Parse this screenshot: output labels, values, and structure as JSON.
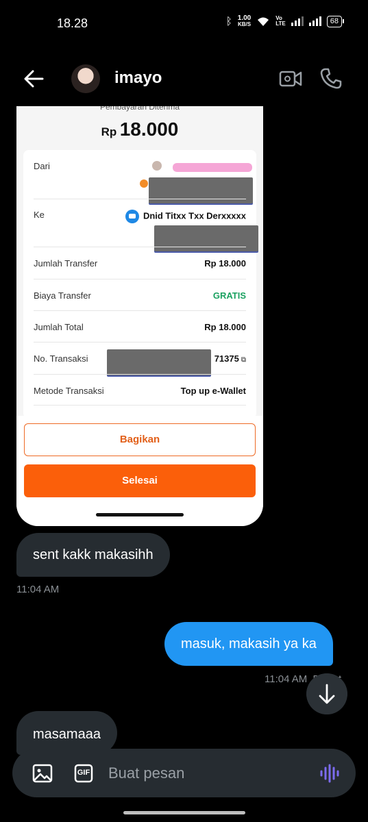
{
  "status_bar": {
    "time": "18.28",
    "net_speed_value": "1.00",
    "net_speed_unit": "KB/S",
    "volte_top": "Vo",
    "volte_bottom": "LTE",
    "battery": "68"
  },
  "header": {
    "contact_name": "imayo"
  },
  "receipt": {
    "subtitle": "Pembayaran Diterima",
    "currency": "Rp",
    "amount": "18.000",
    "rows": [
      {
        "label": "Dari",
        "value": ""
      },
      {
        "label": "Ke",
        "value": "Dnid Titxx Txx Derxxxxx"
      },
      {
        "label": "Jumlah Transfer",
        "value": "Rp 18.000"
      },
      {
        "label": "Biaya Transfer",
        "value": "GRATIS"
      },
      {
        "label": "Jumlah Total",
        "value": "Rp 18.000"
      },
      {
        "label": "No. Transaksi",
        "value": "71375"
      },
      {
        "label": "Metode Transaksi",
        "value": "Top up e-Wallet"
      }
    ],
    "share_label": "Bagikan",
    "done_label": "Selesai",
    "colors": {
      "accent": "#fb5f0a",
      "success": "#1aa160"
    }
  },
  "messages": [
    {
      "direction": "in",
      "text": "sent kakk makasihh",
      "time": "11:04 AM"
    },
    {
      "direction": "out",
      "text": "masuk, makasih ya ka",
      "time": "11:04 AM",
      "status": "Dilihat"
    },
    {
      "direction": "in",
      "text": "masamaaa"
    }
  ],
  "composer": {
    "placeholder": "Buat pesan",
    "gif_label": "GIF"
  },
  "colors": {
    "outgoing_bubble": "#2196f3",
    "incoming_bubble": "#262c31",
    "voice_icon": "#7c6cf0"
  }
}
